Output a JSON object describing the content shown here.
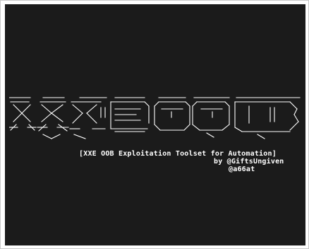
{
  "terminal": {
    "background": "#1b1b1b",
    "text_color": "#ffffff",
    "banner_art": "XXExOOB ascii-art banner",
    "tagline_title": "[XXE OOB Exploitation Toolset for Automation]",
    "tagline_author": "by @GiftsUngiven",
    "tagline_handle": "@a66at"
  }
}
